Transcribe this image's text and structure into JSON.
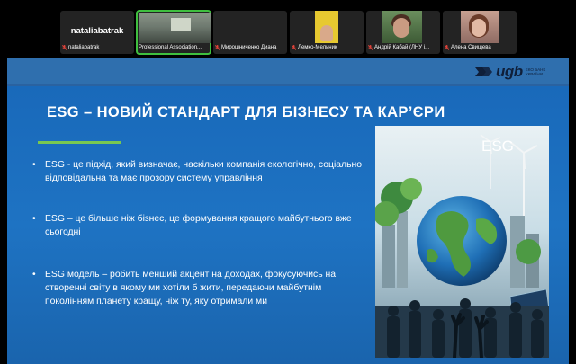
{
  "participants": [
    {
      "display": "nataliabatrak",
      "label": "nataliabatrak",
      "active": false
    },
    {
      "display": "",
      "label": "Professional Association...",
      "active": true
    },
    {
      "display": "",
      "label": "Мирошниченко Диана",
      "active": false
    },
    {
      "display": "",
      "label": "Лемко-Мельник",
      "active": false
    },
    {
      "display": "",
      "label": "Андрій Кабай (ЛНУ і...",
      "active": false
    },
    {
      "display": "",
      "label": "Алена Свищева",
      "active": false
    }
  ],
  "slide": {
    "logo": {
      "text": "ugb",
      "subtitle": "ЕКО БАНК УКРАЇНИ"
    },
    "title": "ESG – НОВИЙ СТАНДАРТ ДЛЯ БІЗНЕСУ ТА КАР’ЄРИ",
    "bullet_symbol": "•",
    "bullets": [
      "ESG - це підхід, який визначає, наскільки компанія екологічно, соціально відповідальна та має прозору систему управління",
      "ESG – це більше ніж бізнес, це формування кращого майбутнього вже сьогодні",
      "ESG модель – робить менший акцент на доходах, фокусуючись на створенні світу в якому ми хотіли б жити, передаючи майбутнім поколінням планету кращу, ніж ту, яку отримали ми"
    ],
    "illustration_label": "ESG"
  },
  "colors": {
    "slide_bg": "#1e73c3",
    "accent_rule": "#78c850",
    "active_tile_border": "#3fbf3f",
    "mic_muted": "#e0433a"
  }
}
